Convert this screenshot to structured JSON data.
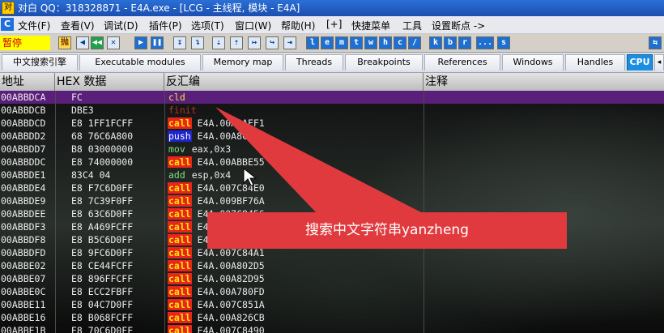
{
  "window": {
    "title": "对白 QQ：318328871 - E4A.exe - [LCG - 主线程, 模块 - E4A]",
    "icon_label": "对"
  },
  "menu": {
    "app_icon": "C",
    "items": [
      "文件(F)",
      "查看(V)",
      "调试(D)",
      "插件(P)",
      "选项(T)",
      "窗口(W)",
      "帮助(H)",
      "[+]",
      "快捷菜单",
      "工具",
      "设置断点 ->"
    ]
  },
  "toolbar": {
    "status": "暂停",
    "buttons_left": [
      "抛",
      "◀",
      "◀◀",
      "✕",
      "▶",
      "❚❚",
      "↧",
      "↴",
      "⇣",
      "⇡",
      "↦",
      "↪",
      "⇥"
    ],
    "buttons_right": [
      "l",
      "e",
      "m",
      "t",
      "w",
      "h",
      "c",
      "/",
      "k",
      "b",
      "r",
      "...",
      "s"
    ],
    "refresh_icon": "⇆"
  },
  "tabs": [
    "中文搜索引擎",
    "Executable modules",
    "Memory map",
    "Threads",
    "Breakpoints",
    "References",
    "Windows",
    "Handles",
    "CPU"
  ],
  "active_tab": "CPU",
  "columns": {
    "address": "地址",
    "hex": "HEX 数据",
    "disasm": "反汇编",
    "comment": "注释"
  },
  "rows": [
    {
      "addr": "00ABBDCA",
      "hex": "FC",
      "mnemonic": "cld",
      "operand": "",
      "sel": true
    },
    {
      "addr": "00ABBDCB",
      "hex": "DBE3",
      "mnemonic": "finit",
      "operand": ""
    },
    {
      "addr": "00ABBDCD",
      "hex": "E8 1FF1FCFF",
      "mnemonic": "call",
      "operand": "E4A.00A8AEF1"
    },
    {
      "addr": "00ABBDD2",
      "hex": "68 76C6A800",
      "mnemonic": "push",
      "operand": "E4A.00A8C676"
    },
    {
      "addr": "00ABBDD7",
      "hex": "B8 03000000",
      "mnemonic": "mov",
      "operand": "eax,0x3"
    },
    {
      "addr": "00ABBDDC",
      "hex": "E8 74000000",
      "mnemonic": "call",
      "operand": "E4A.00ABBE55"
    },
    {
      "addr": "00ABBDE1",
      "hex": "83C4 04",
      "mnemonic": "add",
      "operand": "esp,0x4"
    },
    {
      "addr": "00ABBDE4",
      "hex": "E8 F7C6D0FF",
      "mnemonic": "call",
      "operand": "E4A.007C84E0"
    },
    {
      "addr": "00ABBDE9",
      "hex": "E8 7C39F0FF",
      "mnemonic": "call",
      "operand": "E4A.009BF76A"
    },
    {
      "addr": "00ABBDEE",
      "hex": "E8 63C6D0FF",
      "mnemonic": "call",
      "operand": "E4A.007C8456"
    },
    {
      "addr": "00ABBDF3",
      "hex": "E8 A469FCFF",
      "mnemonic": "call",
      "operand": "E4A.00A8279C"
    },
    {
      "addr": "00ABBDF8",
      "hex": "E8 B5C6D0FF",
      "mnemonic": "call",
      "operand": "E4A.007C84B2"
    },
    {
      "addr": "00ABBDFD",
      "hex": "E8 9FC6D0FF",
      "mnemonic": "call",
      "operand": "E4A.007C84A1"
    },
    {
      "addr": "00ABBE02",
      "hex": "E8 CE44FCFF",
      "mnemonic": "call",
      "operand": "E4A.00A802D5"
    },
    {
      "addr": "00ABBE07",
      "hex": "E8 896FFCFF",
      "mnemonic": "call",
      "operand": "E4A.00A82D95"
    },
    {
      "addr": "00ABBE0C",
      "hex": "E8 ECC2FBFF",
      "mnemonic": "call",
      "operand": "E4A.00A780FD"
    },
    {
      "addr": "00ABBE11",
      "hex": "E8 04C7D0FF",
      "mnemonic": "call",
      "operand": "E4A.007C851A"
    },
    {
      "addr": "00ABBE16",
      "hex": "E8 B068FCFF",
      "mnemonic": "call",
      "operand": "E4A.00A826CB"
    },
    {
      "addr": "00ABBE1B",
      "hex": "E8 70C6D0FF",
      "mnemonic": "call",
      "operand": "E4A.007C8490"
    }
  ],
  "annotation": {
    "text": "搜索中文字符串yanzheng",
    "color": "#e03a3e"
  }
}
